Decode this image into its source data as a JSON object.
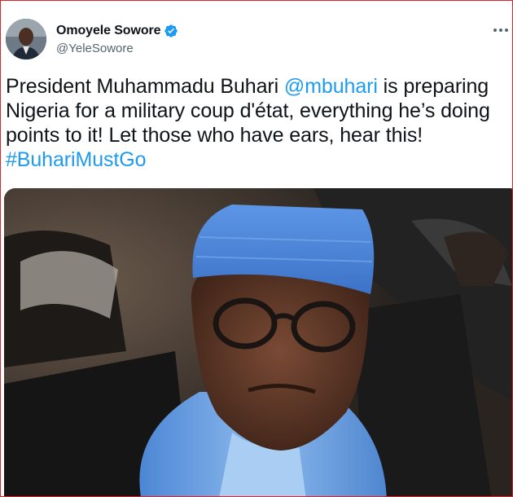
{
  "author": {
    "display_name": "Omoyele Sowore",
    "handle": "@YeleSowore",
    "verified": true,
    "avatar_icon": "profile-photo"
  },
  "menu": {
    "more_label": "···",
    "icon": "more-horizontal-icon"
  },
  "tweet": {
    "segments": [
      {
        "text": "President Muhammadu Buhari ",
        "type": "text"
      },
      {
        "text": "@mbuhari",
        "type": "mention"
      },
      {
        "text": " is preparing Nigeria for a military coup d'état, everything he’s doing points to it! Let those who have ears, hear this! ",
        "type": "text"
      },
      {
        "text": "#BuhariMustGo",
        "type": "hashtag"
      }
    ]
  },
  "media": {
    "type": "photo",
    "description_icon": "photo-of-man-in-blue-cap"
  },
  "colors": {
    "link": "#1d9bf0",
    "text": "#0f1419",
    "secondary": "#536471",
    "border": "#e0242b",
    "verified": "#1d9bf0"
  }
}
